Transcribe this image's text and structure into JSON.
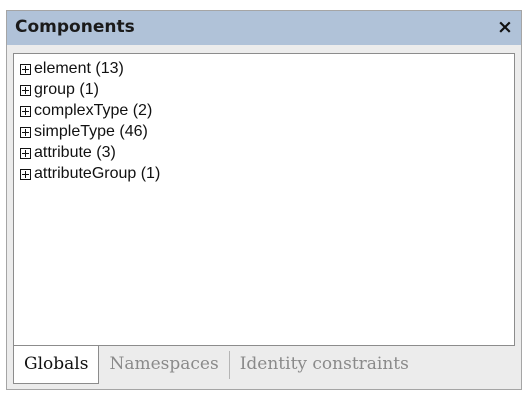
{
  "panel": {
    "title": "Components",
    "close_glyph": "×"
  },
  "tree": {
    "items": [
      {
        "label": "element (13)",
        "icon": "plus-box-icon"
      },
      {
        "label": "group (1)",
        "icon": "plus-box-icon"
      },
      {
        "label": "complexType (2)",
        "icon": "plus-box-icon"
      },
      {
        "label": "simpleType (46)",
        "icon": "plus-box-icon"
      },
      {
        "label": "attribute (3)",
        "icon": "plus-box-icon"
      },
      {
        "label": "attributeGroup (1)",
        "icon": "plus-box-icon"
      }
    ]
  },
  "tabs": [
    {
      "label": "Globals",
      "active": true
    },
    {
      "label": "Namespaces",
      "active": false
    },
    {
      "label": "Identity constraints",
      "active": false
    }
  ],
  "colors": {
    "titlebar": "#b0c2d8",
    "panel_bg": "#ececec",
    "tree_bg": "#ffffff",
    "inactive_tab_text": "#8a8a8a"
  }
}
